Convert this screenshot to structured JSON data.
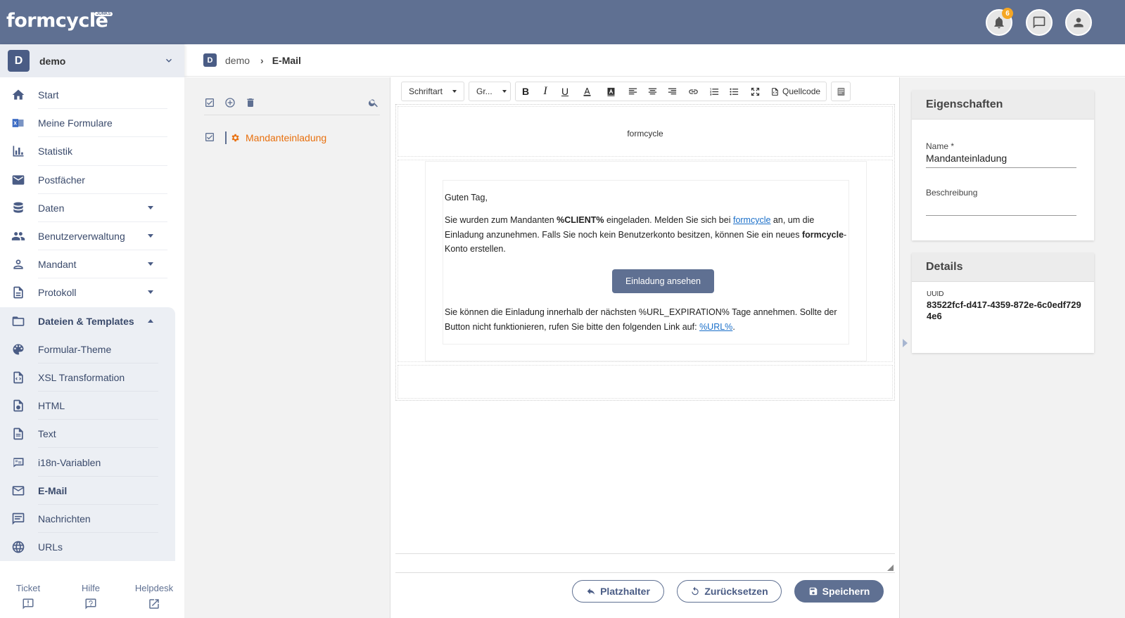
{
  "app": {
    "logo": "formcycle",
    "logo_badge": "JUNKS",
    "notification_count": "6"
  },
  "tenant": {
    "avatar": "D",
    "name": "demo"
  },
  "sidebar": {
    "items": [
      {
        "label": "Start"
      },
      {
        "label": "Meine Formulare"
      },
      {
        "label": "Statistik"
      },
      {
        "label": "Postfächer"
      },
      {
        "label": "Daten"
      },
      {
        "label": "Benutzerverwaltung"
      },
      {
        "label": "Mandant"
      },
      {
        "label": "Protokoll"
      },
      {
        "label": "Dateien & Templates"
      },
      {
        "label": "Formular-Theme"
      },
      {
        "label": "XSL Transformation"
      },
      {
        "label": "HTML"
      },
      {
        "label": "Text"
      },
      {
        "label": "i18n-Variablen"
      },
      {
        "label": "E-Mail"
      },
      {
        "label": "Nachrichten"
      },
      {
        "label": "URLs"
      }
    ],
    "footer": {
      "ticket": "Ticket",
      "help": "Hilfe",
      "helpdesk": "Helpdesk"
    }
  },
  "breadcrumb": {
    "avatar": "D",
    "tenant": "demo",
    "separator": "›",
    "current": "E-Mail"
  },
  "list": {
    "items": [
      {
        "name": "Mandanteinladung"
      }
    ]
  },
  "editor": {
    "toolbar": {
      "font": "Schriftart",
      "size": "Gr...",
      "bold": "B",
      "italic": "I",
      "underline": "U",
      "source": "Quellcode"
    },
    "header_brand": "formcycle",
    "mail": {
      "greeting": "Guten Tag,",
      "p2_a": "Sie wurden zum Mandanten ",
      "p2_client": "%CLIENT%",
      "p2_b": " eingeladen. Melden Sie sich bei ",
      "p2_link": "formcycle",
      "p2_c": " an, um die Einladung anzunehmen. Falls Sie noch kein Benutzerkonto besitzen, können Sie ein neues ",
      "p2_brand": "formcycle",
      "p2_d": "-Konto erstellen.",
      "button": "Einladung ansehen",
      "p3_a": "Sie können die Einladung innerhalb der nächsten %URL_EXPIRATION% Tage annehmen. Sollte der Button nicht funktionieren, rufen Sie bitte den folgenden Link auf: ",
      "p3_link": "%URL%",
      "p3_b": "."
    },
    "buttons": {
      "placeholder": "Platzhalter",
      "reset": "Zurücksetzen",
      "save": "Speichern"
    }
  },
  "properties": {
    "title": "Eigenschaften",
    "name_label": "Name *",
    "name_value": "Mandanteinladung",
    "description_label": "Beschreibung",
    "description_value": ""
  },
  "details": {
    "title": "Details",
    "uuid_label": "UUID",
    "uuid_value": "83522fcf-d417-4359-872e-6c0edf7294e6"
  },
  "colors": {
    "header": "#5f7092",
    "accent_orange": "#e8700e",
    "nav_text": "#3a4a6b"
  }
}
